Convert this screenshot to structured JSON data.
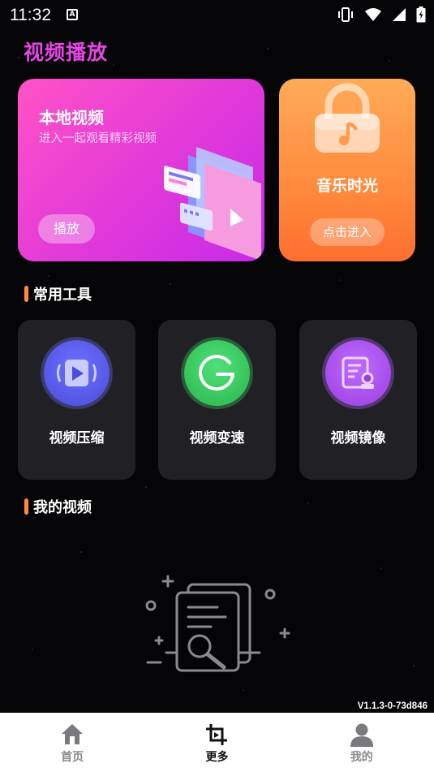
{
  "status_bar": {
    "time": "11:32",
    "badge": "A"
  },
  "app_title": "视频播放",
  "banner_local": {
    "title": "本地视频",
    "subtitle": "进入一起观看精彩视频",
    "button": "播放"
  },
  "banner_music": {
    "title": "音乐时光",
    "button": "点击进入"
  },
  "tools_section": {
    "title": "常用工具",
    "items": [
      {
        "label": "视频压缩",
        "icon": "video-compress-icon",
        "color": "#5b5df0"
      },
      {
        "label": "视频变速",
        "icon": "speed-gauge-icon",
        "color": "#36c95a"
      },
      {
        "label": "视频镜像",
        "icon": "mirror-document-icon",
        "color": "#a94ee8"
      }
    ]
  },
  "my_videos_section": {
    "title": "我的视频"
  },
  "version": "V1.1.3-0-73d846",
  "nav": [
    {
      "label": "首页",
      "icon": "home-icon",
      "active": false
    },
    {
      "label": "更多",
      "icon": "crop-icon",
      "active": true
    },
    {
      "label": "我的",
      "icon": "person-icon",
      "active": false
    }
  ]
}
